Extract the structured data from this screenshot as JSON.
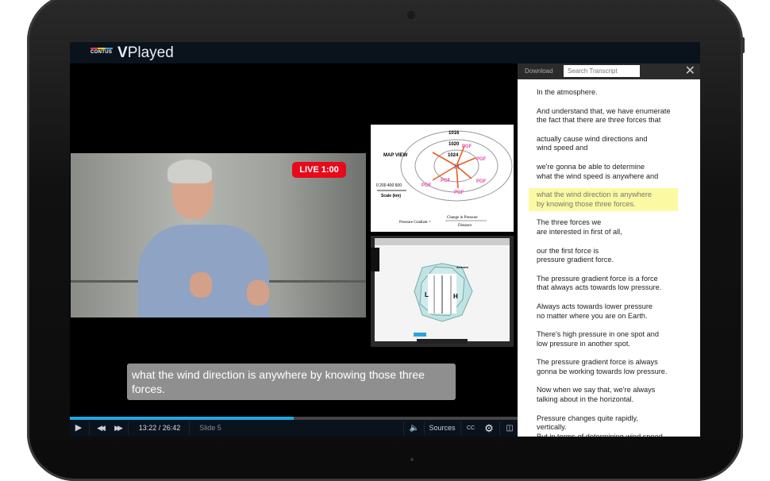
{
  "app": {
    "brand_small": "CONTUS",
    "brand_bold": "V",
    "brand_rest": "Played"
  },
  "player": {
    "live_badge": "LIVE 1:00",
    "caption": "what the wind direction is anywhere by knowing those three forces.",
    "progress_percent": 50,
    "time": "13:22 / 26:42",
    "slide": "Slide 5",
    "sources": "Sources",
    "cc": "CC",
    "accent": "#1ba9e5"
  },
  "slide1": {
    "title": "MAP VIEW",
    "isobars": [
      "1016",
      "1020",
      "1024"
    ],
    "center": "H",
    "arrow_label": "PGF",
    "scale": "0  200 400 600",
    "scale_label": "Scale (km)",
    "formula_left": "Pressure Gradient =",
    "formula_num": "Change in Pressure",
    "formula_den": "Distance"
  },
  "slide2": {
    "label_l": "L",
    "label_h": "H",
    "place": "Arizona"
  },
  "transcript": {
    "download": "Download",
    "search_placeholder": "Search Transcript",
    "highlight_color": "#fbfaa2",
    "paragraphs": [
      {
        "lines": [
          "In the atmosphere."
        ]
      },
      {
        "lines": [
          "And understand that, we have enumerate",
          "the fact that there are three forces that"
        ]
      },
      {
        "lines": [
          "actually cause wind directions and",
          "wind speed and"
        ]
      },
      {
        "lines": [
          "we're gonna be able to determine",
          "what the wind speed is anywhere and"
        ]
      },
      {
        "lines": [
          "what the wind direction is anywhere",
          "by knowing those three forces."
        ],
        "active": true
      },
      {
        "lines": [
          "The three forces we",
          "are interested in first of all,"
        ]
      },
      {
        "lines": [
          "our the first force is",
          "pressure gradient force."
        ]
      },
      {
        "lines": [
          "The pressure gradient force is a force",
          "that always acts towards low pressure."
        ]
      },
      {
        "lines": [
          "Always acts towards lower pressure",
          "no matter where you are on Earth."
        ]
      },
      {
        "lines": [
          "There's high pressure in one spot and",
          "low pressure in another spot."
        ]
      },
      {
        "lines": [
          "The pressure gradient force is always",
          "gonna be working towards low pressure."
        ]
      },
      {
        "lines": [
          "Now when we say that, we're always",
          "talking about in the horizontal."
        ]
      },
      {
        "lines": [
          "Pressure changes quite rapidly,",
          "vertically.",
          "But in terms of determining wind speed,"
        ]
      }
    ]
  }
}
